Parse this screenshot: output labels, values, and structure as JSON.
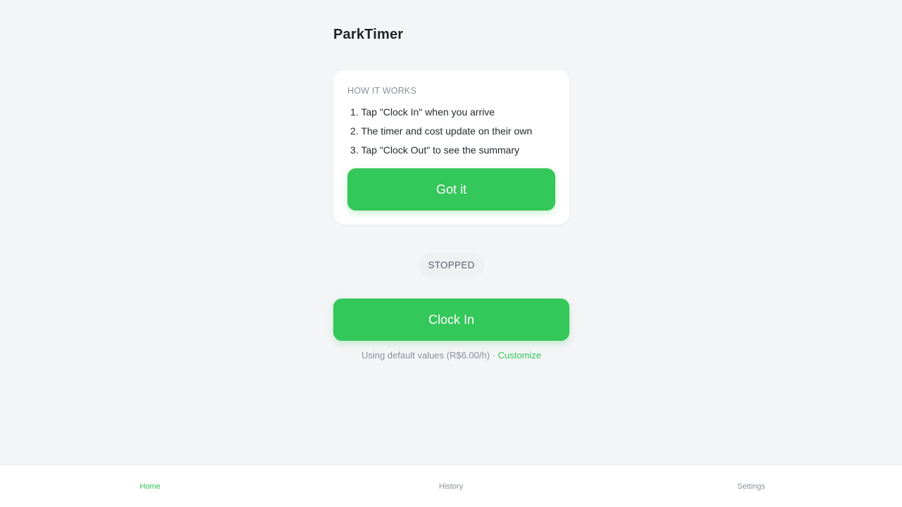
{
  "app": {
    "title": "ParkTimer"
  },
  "how_it_works": {
    "heading": "HOW IT WORKS",
    "steps": [
      "1. Tap \"Clock In\" when you arrive",
      "2. The timer and cost update on their own",
      "3. Tap \"Clock Out\" to see the summary"
    ],
    "dismiss_label": "Got it"
  },
  "status": {
    "label": "STOPPED"
  },
  "main": {
    "clock_in_label": "Clock In",
    "defaults_text": "Using default values (R$6.00/h) · ",
    "customize_label": "Customize"
  },
  "nav": {
    "items": [
      {
        "label": "Home",
        "active": true
      },
      {
        "label": "History",
        "active": false
      },
      {
        "label": "Settings",
        "active": false
      }
    ]
  },
  "colors": {
    "accent": "#34c759",
    "background": "#f4f5f7",
    "card": "#ffffff",
    "muted_text": "#8a8f98"
  }
}
